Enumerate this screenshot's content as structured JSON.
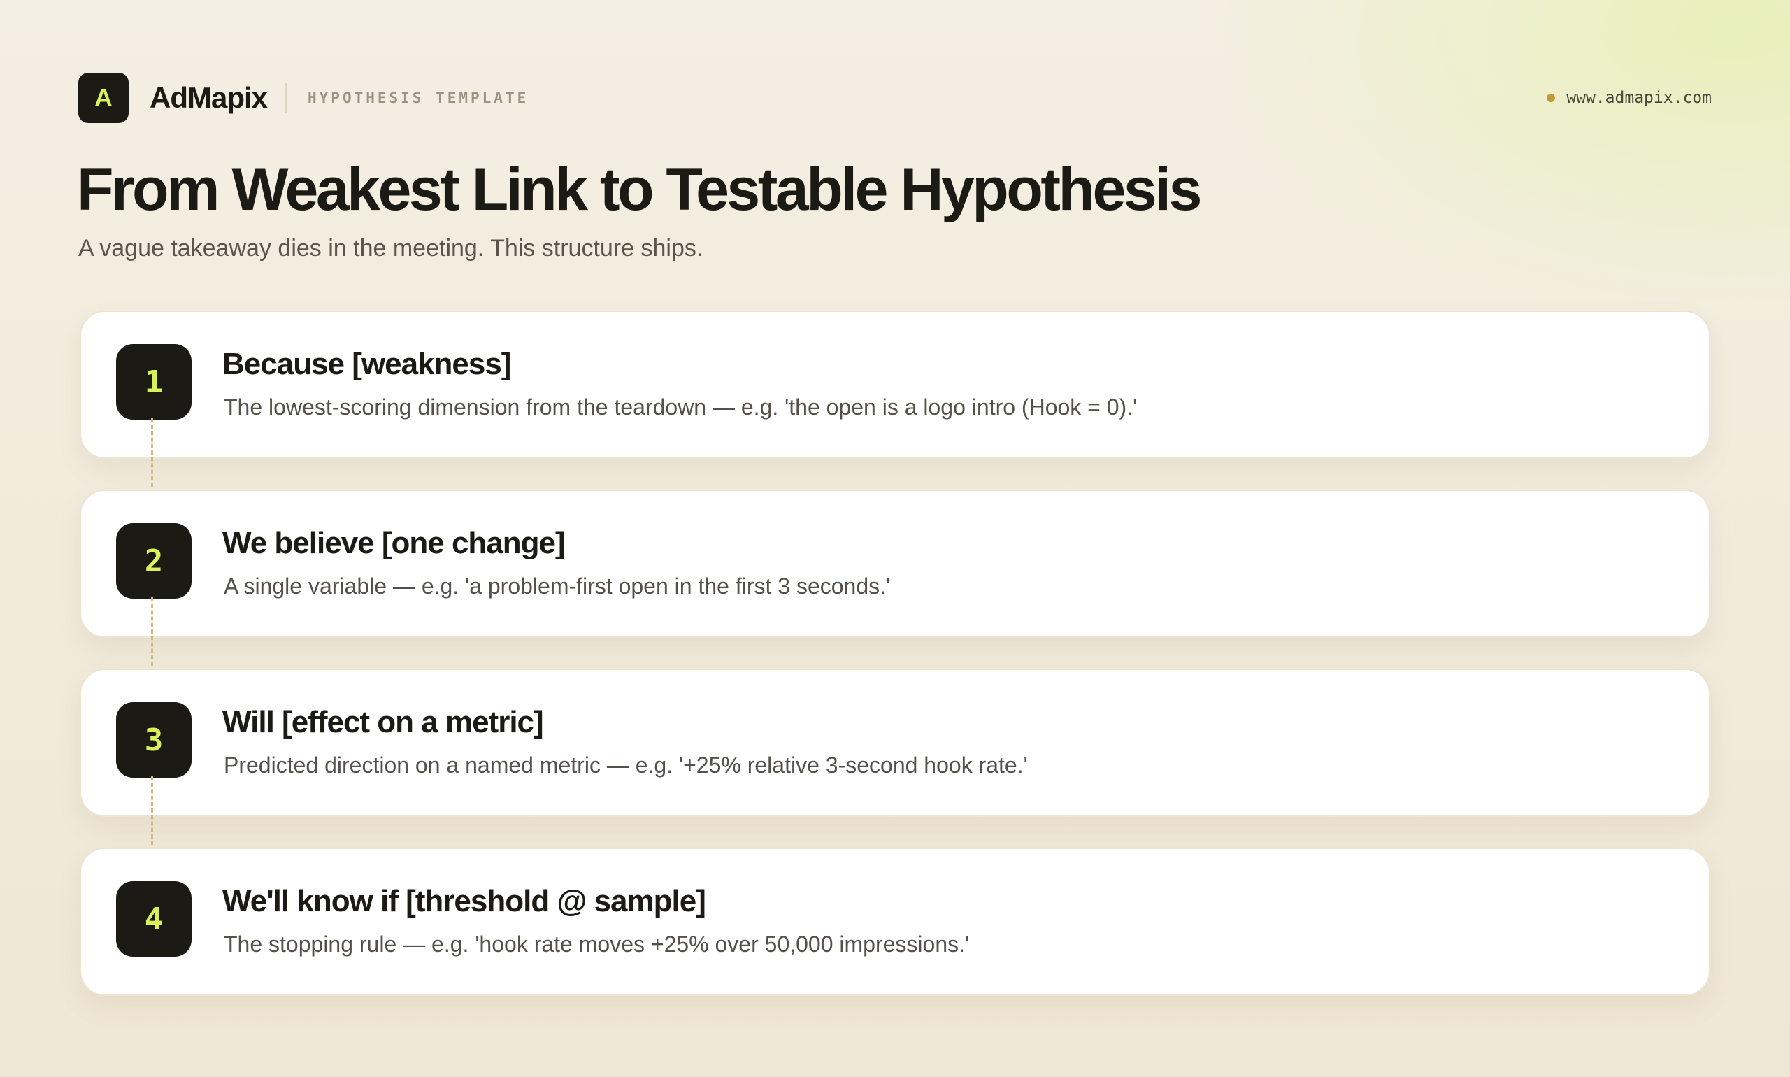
{
  "brand": {
    "logo_letter": "A",
    "name": "AdMapix",
    "tag": "HYPOTHESIS TEMPLATE"
  },
  "site": {
    "url": "www.admapix.com"
  },
  "page": {
    "title": "From Weakest Link to Testable Hypothesis",
    "subtitle": "A vague takeaway dies in the meeting. This structure ships."
  },
  "colors": {
    "accent_lime": "#d9f25a",
    "ink": "#1c1a14",
    "dot_gold": "#c19a3d"
  },
  "steps": [
    {
      "number": "1",
      "title": "Because [weakness]",
      "description": "The lowest-scoring dimension from the teardown — e.g. 'the open is a logo intro (Hook = 0).'"
    },
    {
      "number": "2",
      "title": "We believe [one change]",
      "description": "A single variable — e.g. 'a problem-first open in the first 3 seconds.'"
    },
    {
      "number": "3",
      "title": "Will [effect on a metric]",
      "description": "Predicted direction on a named metric — e.g. '+25% relative 3-second hook rate.'"
    },
    {
      "number": "4",
      "title": "We'll know if [threshold @ sample]",
      "description": "The stopping rule — e.g. 'hook rate moves +25% over 50,000 impressions.'"
    }
  ]
}
